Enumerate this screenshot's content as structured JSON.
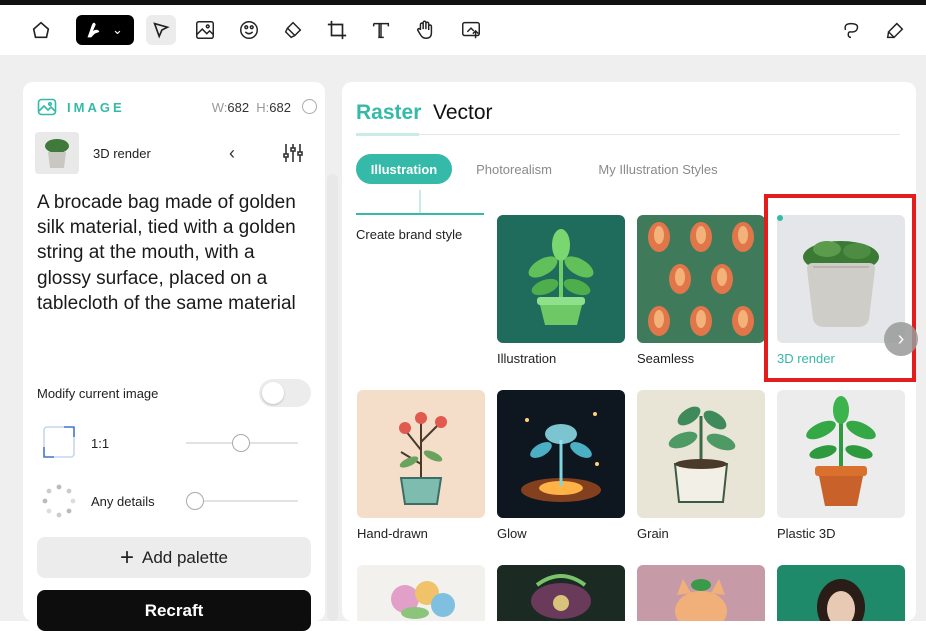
{
  "toolbar": {
    "tools": [
      "home-icon",
      "brush-tool-icon",
      "select-tool-icon",
      "image-frame-icon",
      "palette-icon",
      "eraser-icon",
      "crop-icon",
      "text-tool-icon",
      "hand-tool-icon",
      "upload-icon",
      "lasso-icon",
      "clear-icon"
    ]
  },
  "image_panel": {
    "title": "IMAGE",
    "width_label": "W:",
    "width_value": "682",
    "height_label": "H:",
    "height_value": "682",
    "style_name": "3D render",
    "back_glyph": "‹",
    "prompt": "A brocade bag made of golden silk material, tied with a golden string at the mouth, with a glossy surface, placed on a tablecloth of the same material",
    "modify_label": "Modify current image",
    "modify_on": false,
    "aspect_ratio": "1:1",
    "details_label": "Any details",
    "add_palette_label": "Add palette",
    "recraft_label": "Recraft"
  },
  "styles_panel": {
    "tabs": [
      "Raster",
      "Vector"
    ],
    "active_tab": "Raster",
    "chips": [
      "Illustration",
      "Photorealism",
      "My Illustration Styles"
    ],
    "active_chip": "Illustration",
    "brand_label": "Create brand style",
    "cards": [
      {
        "label": "Illustration"
      },
      {
        "label": "Seamless"
      },
      {
        "label": "3D render",
        "selected": true
      },
      {
        "label": "Hand-drawn"
      },
      {
        "label": "Glow"
      },
      {
        "label": "Grain"
      },
      {
        "label": "Plastic 3D"
      }
    ]
  },
  "colors": {
    "accent": "#35b9a8",
    "highlight": "#e11d1d",
    "primary_button": "#0d0d0d"
  }
}
